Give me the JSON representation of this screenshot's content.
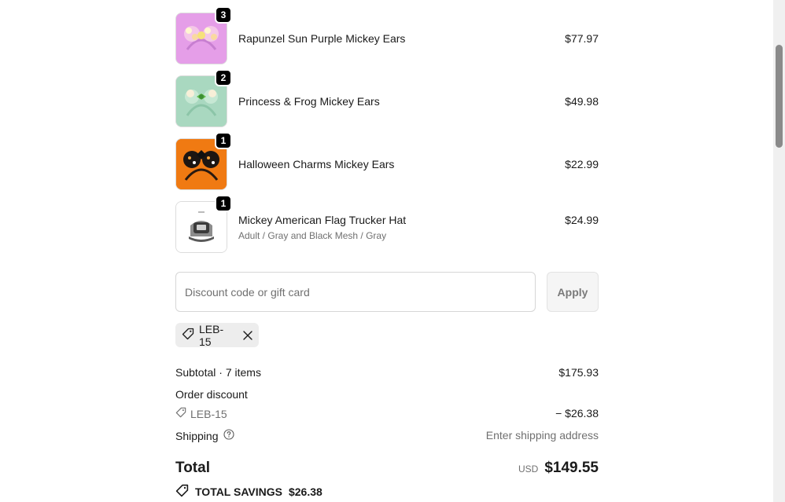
{
  "line_items": [
    {
      "qty": "3",
      "name": "Rapunzel Sun Purple Mickey Ears",
      "variant": "",
      "price": "$77.97",
      "thumb_bg": "#e59ee8",
      "icon": "mickey-ears-icon"
    },
    {
      "qty": "2",
      "name": "Princess & Frog Mickey Ears",
      "variant": "",
      "price": "$49.98",
      "thumb_bg": "#a9d8c0",
      "icon": "mickey-ears-icon"
    },
    {
      "qty": "1",
      "name": "Halloween Charms Mickey Ears",
      "variant": "",
      "price": "$22.99",
      "thumb_bg": "#f07a12",
      "icon": "mickey-ears-icon"
    },
    {
      "qty": "1",
      "name": "Mickey American Flag Trucker Hat",
      "variant": "Adult / Gray and Black Mesh / Gray",
      "price": "$24.99",
      "thumb_bg": "#ffffff",
      "icon": "trucker-hat-icon"
    }
  ],
  "discount": {
    "placeholder": "Discount code or gift card",
    "apply_label": "Apply",
    "applied_code": "LEB-15"
  },
  "summary": {
    "subtotal_label": "Subtotal · 7 items",
    "subtotal_value": "$175.93",
    "order_discount_label": "Order discount",
    "discount_code": "LEB-15",
    "discount_value": "− $26.38",
    "shipping_label": "Shipping",
    "shipping_value": "Enter shipping address",
    "total_label": "Total",
    "currency": "USD",
    "total_value": "$149.55",
    "savings_label": "TOTAL SAVINGS",
    "savings_value": "$26.38"
  },
  "colors": {
    "badge": "#000000",
    "muted_text": "#707070",
    "chip_bg": "#ededed"
  }
}
